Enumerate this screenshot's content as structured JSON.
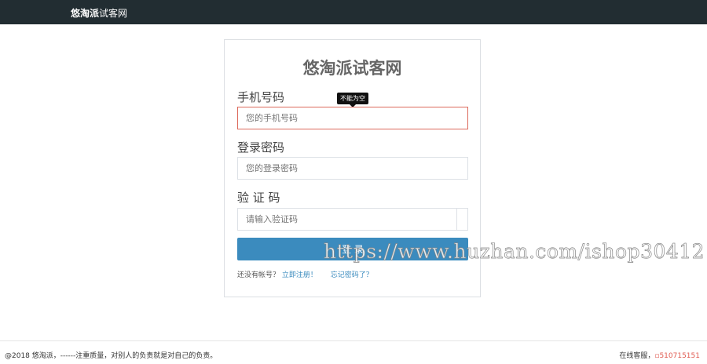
{
  "header": {
    "brand_bold": "悠淘派",
    "brand_rest": "试客网"
  },
  "form": {
    "title": "悠淘派试客网",
    "phone_label": "手机号码",
    "phone_placeholder": "您的手机号码",
    "phone_error_tip": "不能为空",
    "password_label": "登录密码",
    "password_placeholder": "您的登录密码",
    "code_label": "验 证 码",
    "code_placeholder": "请输入验证码",
    "login_label": "登 录",
    "no_account": "还没有帐号？",
    "register_link": "立即注册！",
    "forgot_link": "忘记密码了？"
  },
  "footer": {
    "copyright": "@2018 悠淘派，------注重质量，对别人的负责就是对自己的负责。",
    "service_label": "在线客服，",
    "service_icon": "qq-icon",
    "service_number": "510715151"
  },
  "watermark": "https://www.huzhan.com/ishop30412",
  "colors": {
    "topbar": "#222d32",
    "primary": "#3b8bbe",
    "error": "#dd6a5c"
  }
}
